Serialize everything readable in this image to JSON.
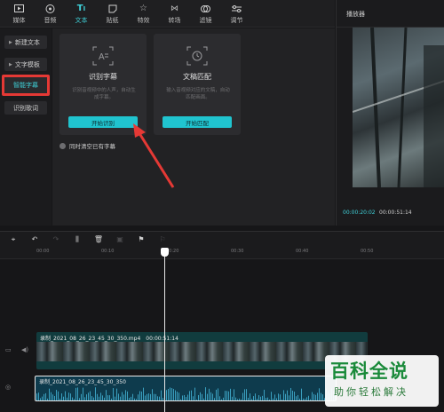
{
  "toolbar": {
    "tabs": [
      {
        "label": "媒体",
        "icon": "media-icon"
      },
      {
        "label": "音频",
        "icon": "audio-icon"
      },
      {
        "label": "文本",
        "icon": "text-icon",
        "active": true
      },
      {
        "label": "贴纸",
        "icon": "sticker-icon"
      },
      {
        "label": "特效",
        "icon": "effects-icon"
      },
      {
        "label": "转场",
        "icon": "transition-icon"
      },
      {
        "label": "滤镜",
        "icon": "filter-icon"
      },
      {
        "label": "调节",
        "icon": "adjust-icon"
      }
    ]
  },
  "leftnav": {
    "items": [
      {
        "label": "新建文本"
      },
      {
        "label": "文字模板"
      },
      {
        "label": "智能字幕",
        "selected": true
      },
      {
        "label": "识别歌词"
      }
    ]
  },
  "cards": [
    {
      "title": "识别字幕",
      "desc": "识别音视频中的人声，自动生成字幕。",
      "button": "开始识别",
      "icon": "subtitle-recognize-icon"
    },
    {
      "title": "文稿匹配",
      "desc": "输入音视频对应的文稿，自动匹配画面。",
      "button": "开始匹配",
      "icon": "script-match-icon"
    }
  ],
  "checkbox": {
    "label": "同时清空已有字幕",
    "checked": false
  },
  "player": {
    "title": "播放器",
    "current_time": "00:00:20:02",
    "total_time": "00:00:51:14"
  },
  "ruler": {
    "labels": [
      "00:00",
      "00:10",
      "00:20",
      "00:30",
      "00:40",
      "00:50"
    ]
  },
  "clips": {
    "video": {
      "name": "录制_2021_08_26_23_45_30_350.mp4",
      "duration": "00:00:51:14"
    },
    "audio": {
      "name": "录制_2021_08_26_23_45_30_350"
    }
  },
  "watermark": {
    "big": "百科全说",
    "small": "助你轻松解决"
  },
  "colors": {
    "accent": "#20c4cf",
    "highlight_box": "#e53935",
    "arrow": "#e53935"
  }
}
